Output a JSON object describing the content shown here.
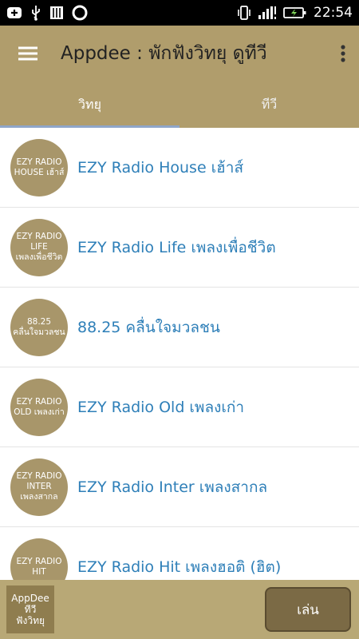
{
  "status_bar": {
    "time": "22:54",
    "left_icons": [
      "add-icon",
      "usb-icon",
      "storage-icon",
      "sync-icon"
    ],
    "right_icons": [
      "vibrate-icon",
      "signal-icon",
      "battery-icon"
    ]
  },
  "app_bar": {
    "title": "Appdee : พักฟังวิทยุ ดูทีวี",
    "menu_icon": "hamburger-menu-icon",
    "overflow_icon": "more-vert-icon"
  },
  "tabs": [
    {
      "label": "วิทยุ",
      "active": true
    },
    {
      "label": "ทีวี",
      "active": false
    }
  ],
  "stations": [
    {
      "avatar_lines": [
        "EZY RADIO",
        "HOUSE เฮ้าส์"
      ],
      "title": "EZY Radio House เฮ้าส์"
    },
    {
      "avatar_lines": [
        "EZY RADIO",
        "LIFE",
        "เพลงเพื่อชีวิต"
      ],
      "title": "EZY Radio Life เพลงเพื่อชีวิต"
    },
    {
      "avatar_lines": [
        "88.25",
        "คลื่นใจมวลชน"
      ],
      "title": "88.25 คลื่นใจมวลชน"
    },
    {
      "avatar_lines": [
        "EZY RADIO",
        "OLD เพลงเก่า"
      ],
      "title": "EZY Radio Old เพลงเก่า"
    },
    {
      "avatar_lines": [
        "EZY RADIO",
        "INTER",
        "เพลงสากล"
      ],
      "title": "EZY Radio Inter เพลงสากล"
    },
    {
      "avatar_lines": [
        "EZY RADIO",
        "HIT"
      ],
      "title": "EZY Radio Hit เพลงฮอติ (ฮิต)"
    }
  ],
  "ad_bar": {
    "logo_lines": [
      "AppDee",
      "ทีวี",
      "ฟังวิทยุ"
    ],
    "play_label": "เล่น"
  },
  "colors": {
    "primary": "#b09d6c",
    "link": "#2e7fb8",
    "tab_indicator": "#8fa6c9"
  }
}
